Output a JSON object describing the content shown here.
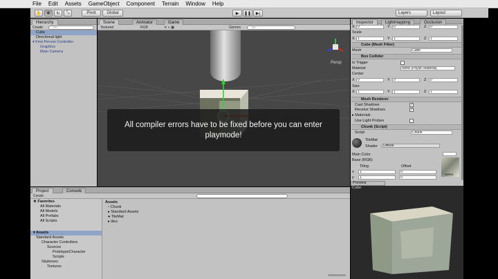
{
  "menu": [
    "File",
    "Edit",
    "Assets",
    "GameObject",
    "Component",
    "Terrain",
    "Window",
    "Help"
  ],
  "toolbar": {
    "pivot": "Pivot",
    "global": "Global",
    "layers": "Layers",
    "layout": "Layout"
  },
  "hierarchy": {
    "tab": "Hierarchy",
    "create": "Create",
    "search_placeholder": "All",
    "items": [
      "Cube",
      "Directional light",
      "First Person Controller",
      "Graphics",
      "Main Camera"
    ]
  },
  "scene": {
    "tabs": [
      "Scene",
      "Animator",
      "Game"
    ],
    "shading": "Textured",
    "render": "RGB",
    "gizmos": "Gizmos",
    "search_placeholder": "All",
    "persp": "Persp"
  },
  "error_message": "All compiler errors have to be fixed before you can enter playmode!",
  "project": {
    "tabs": [
      "Project",
      "Console"
    ],
    "create": "Create",
    "favorites_label": "Favorites",
    "favorites": [
      "All Materials",
      "All Models",
      "All Prefabs",
      "All Scripts"
    ],
    "assets_root": "Assets",
    "tree": [
      "Standard Assets",
      "Character Controllers",
      "Sources",
      "PrototypeCharacter",
      "Scripts",
      "Skyboxes",
      "Textures"
    ],
    "breadcrumb": "Assets",
    "files": [
      "Chunk",
      "Standard Assets",
      "TileMat",
      "tiles"
    ]
  },
  "inspector": {
    "tabs": [
      "Inspector",
      "Lightmapping",
      "Occlusion"
    ],
    "pos_x": "0",
    "pos_y": "0",
    "pos_z": "0",
    "scale_label": "Scale",
    "scale_x": "1",
    "scale_y": "1",
    "scale_z": "1",
    "mesh_filter": "Cube (Mesh Filter)",
    "mesh_label": "Mesh",
    "mesh_value": "Cube",
    "box_collider": "Box Collider",
    "is_trigger": "Is Trigger",
    "material_label": "Material",
    "material_value": "None (Physic Material)",
    "center_label": "Center",
    "center_x": "0",
    "center_y": "0",
    "center_z": "0",
    "size_label": "Size",
    "size_x": "1",
    "size_y": "1",
    "size_z": "1",
    "mesh_renderer": "Mesh Renderer",
    "cast_shadows": "Cast Shadows",
    "receive_shadows": "Receive Shadows",
    "materials": "Materials",
    "use_light_probes": "Use Light Probes",
    "chunk_script": "Chunk (Script)",
    "script_label": "Script",
    "script_value": "Chunk",
    "tilemat": "TileMat",
    "shader_label": "Shader",
    "shader_value": "Diffuse",
    "main_color": "Main Color",
    "base_rgb": "Base (RGB)",
    "tiling": "Tiling",
    "offset": "Offset",
    "tiling_x": "1",
    "tiling_y": "1",
    "offset_x": "0",
    "offset_y": "0",
    "select": "Select"
  },
  "preview": {
    "title": "Preview",
    "object": "Cube"
  },
  "colors": {
    "selection": "#8fa4c6",
    "scene_bg": "#474747",
    "overlay": "#191919"
  }
}
